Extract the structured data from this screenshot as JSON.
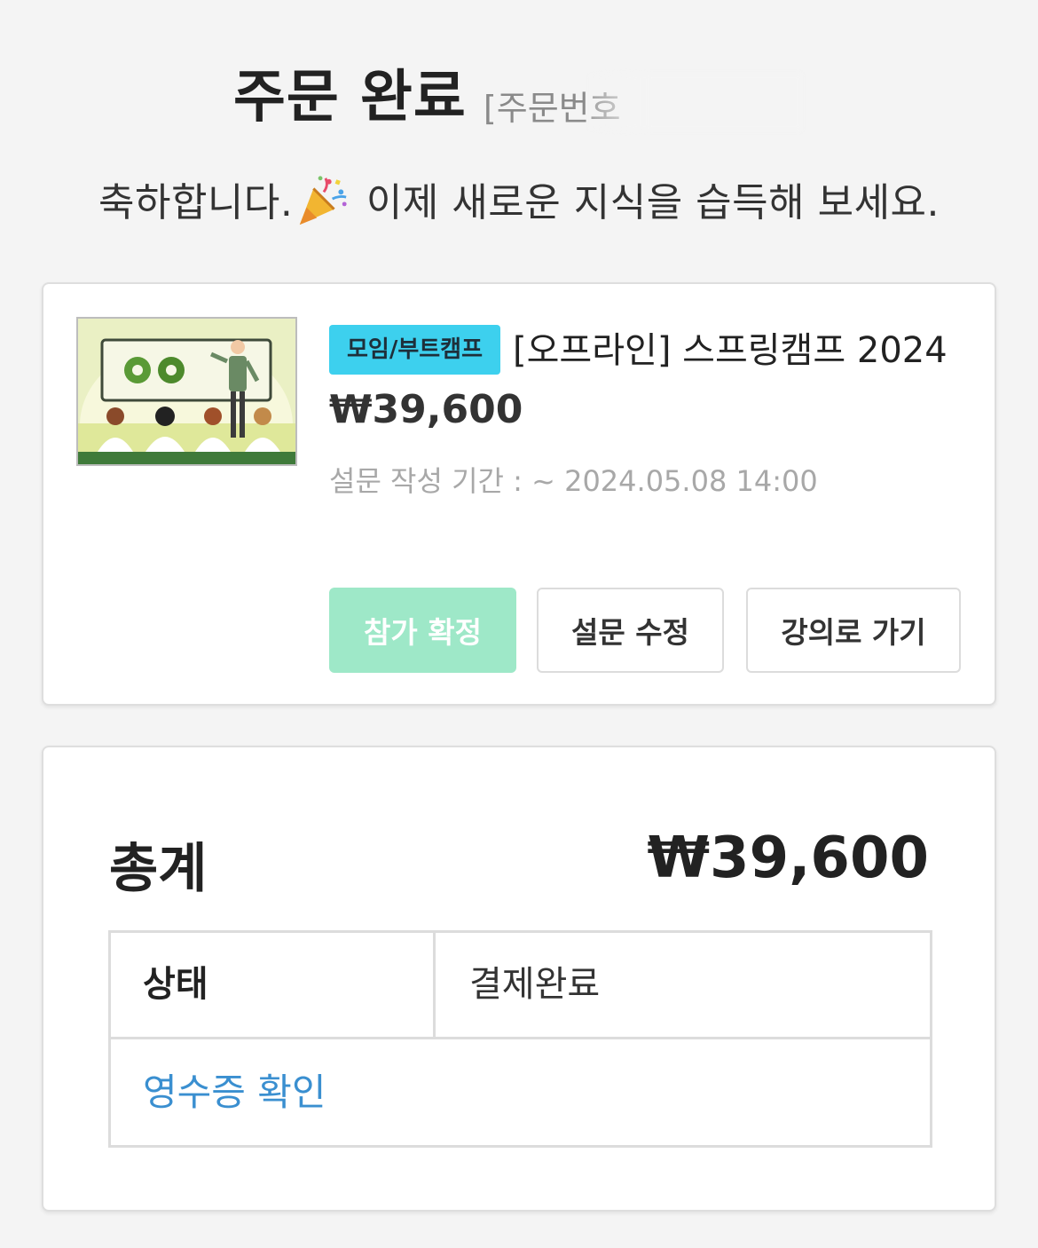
{
  "header": {
    "title": "주문 완료",
    "order_number_label": "[주문번호",
    "subtitle_before": "축하합니다.",
    "subtitle_after": " 이제 새로운 지식을 습득해 보세요."
  },
  "order_item": {
    "category_tag": "모임/부트캠프",
    "course_title": "[오프라인] 스프링캠프 2024",
    "price": "₩39,600",
    "survey_deadline": "설문 작성 기간 : ~ 2024.05.08 14:00",
    "buttons": {
      "confirm": "참가 확정",
      "edit_survey": "설문 수정",
      "go_to_course": "강의로 가기"
    }
  },
  "summary": {
    "total_label": "총계",
    "total_value": "₩39,600",
    "status_label": "상태",
    "status_value": "결제완료",
    "receipt_link": "영수증 확인"
  },
  "colors": {
    "background": "#f4f4f4",
    "tag_bg": "#3dd0ee",
    "confirm_button": "#9ee8c8",
    "link": "#3a8fd0"
  }
}
